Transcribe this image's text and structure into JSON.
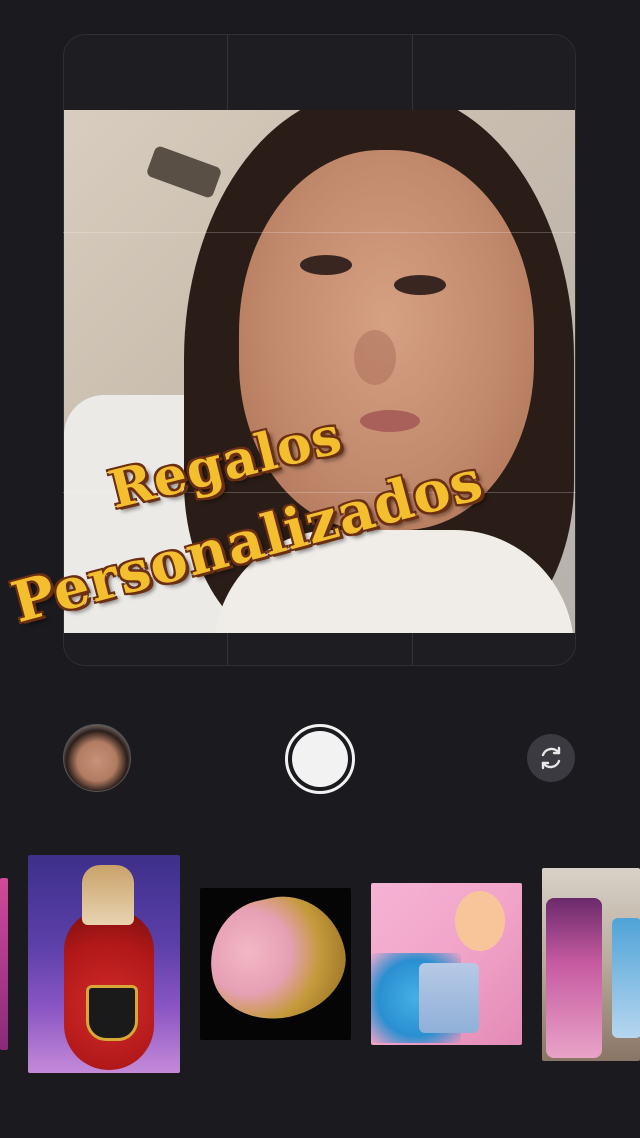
{
  "overlay": {
    "line1": "Regalos",
    "line2": "Personalizados"
  },
  "camera": {
    "shutter_icon": "shutter-button-icon",
    "flip_icon": "flip-camera-icon",
    "gallery_icon": "recent-photo-thumbnail"
  },
  "effects_tray": {
    "items": [
      {
        "name": "pink-partial"
      },
      {
        "name": "red-bottle-chivas"
      },
      {
        "name": "rose-heart-chocolates"
      },
      {
        "name": "pink-doll-gift-set"
      },
      {
        "name": "candle-set"
      }
    ]
  },
  "colors": {
    "background": "#1b1b1f",
    "overlay_text": "#f3bf2e",
    "overlay_outline": "#6b2f12",
    "shutter": "#f2f2f2"
  }
}
